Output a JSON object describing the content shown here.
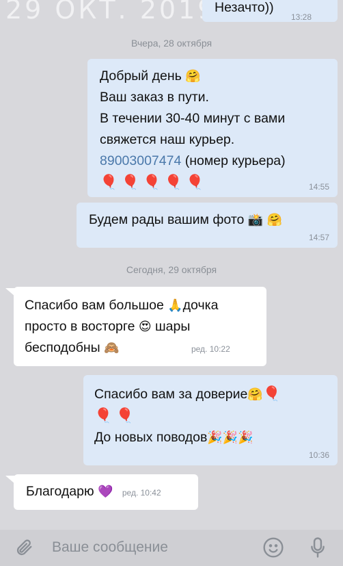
{
  "watermark": "29 ОКТ. 2019 Г.",
  "messages": {
    "m0": {
      "text": "Незачто))",
      "time": "13:28"
    },
    "date1": "Вчера, 28 октября",
    "m1": {
      "line1": "Добрый день",
      "line2": "Ваш заказ в пути.",
      "line3": "В течении 30-40 минут с вами",
      "line4": "свяжется наш курьер.",
      "phone": "89003007474",
      "phone_note": " (номер курьера)",
      "time": "14:55"
    },
    "m2": {
      "text": "Будем рады вашим фото",
      "time": "14:57"
    },
    "date2": "Сегодня, 29 октября",
    "m3": {
      "line1a": "Спасибо вам большое",
      "line1b": "дочка",
      "line2a": "просто в восторге",
      "line2b": "шары",
      "line3": "бесподобны",
      "time": "ред. 10:22"
    },
    "m4": {
      "line1": "Спасибо вам за доверие",
      "line3": "До новых поводов",
      "time": "10:36"
    },
    "m5": {
      "text": "Благодарю",
      "time": "ред. 10:42"
    }
  },
  "composer": {
    "placeholder": "Ваше сообщение"
  },
  "icons": {
    "attach": "paperclip-icon",
    "emoji": "smiley-icon",
    "mic": "microphone-icon",
    "emoji_hug": "hugging-face",
    "emoji_balloon": "red-balloon",
    "emoji_camera": "camera-flash",
    "emoji_pray": "folded-hands",
    "emoji_hearteyes": "heart-eyes",
    "emoji_monkey": "see-no-evil-monkey",
    "emoji_party": "party-popper",
    "emoji_heart": "purple-heart"
  }
}
